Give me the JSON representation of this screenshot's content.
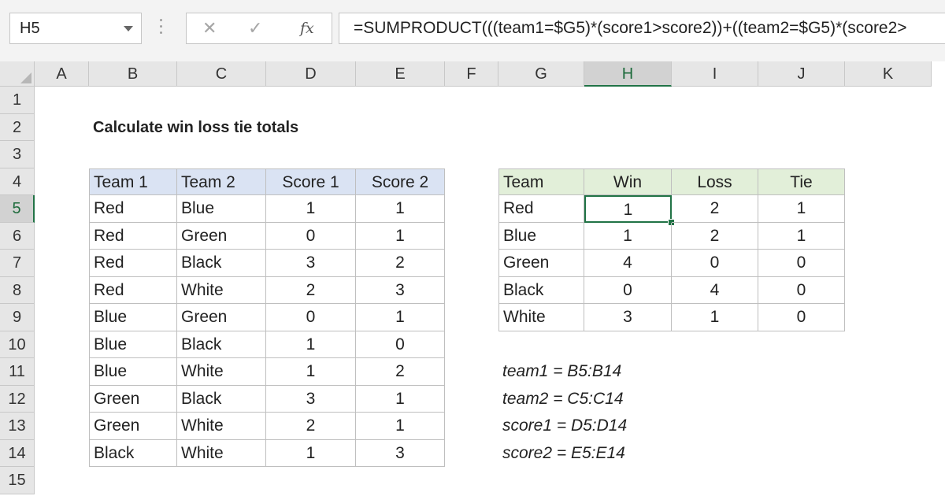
{
  "formula_bar": {
    "name_box": "H5",
    "cancel_icon": "✕",
    "enter_icon": "✓",
    "fx_label": "fx",
    "formula": "=SUMPRODUCT(((team1=$G5)*(score1>score2))+((team2=$G5)*(score2>"
  },
  "columns": [
    "A",
    "B",
    "C",
    "D",
    "E",
    "F",
    "G",
    "H",
    "I",
    "J",
    "K"
  ],
  "rows": [
    "1",
    "2",
    "3",
    "4",
    "5",
    "6",
    "7",
    "8",
    "9",
    "10",
    "11",
    "12",
    "13",
    "14",
    "15"
  ],
  "active_cell": "H5",
  "title": "Calculate win loss tie totals",
  "scores_table": {
    "headers": [
      "Team 1",
      "Team 2",
      "Score 1",
      "Score 2"
    ],
    "rows": [
      [
        "Red",
        "Blue",
        "1",
        "1"
      ],
      [
        "Red",
        "Green",
        "0",
        "1"
      ],
      [
        "Red",
        "Black",
        "3",
        "2"
      ],
      [
        "Red",
        "White",
        "2",
        "3"
      ],
      [
        "Blue",
        "Green",
        "0",
        "1"
      ],
      [
        "Blue",
        "Black",
        "1",
        "0"
      ],
      [
        "Blue",
        "White",
        "1",
        "2"
      ],
      [
        "Green",
        "Black",
        "3",
        "1"
      ],
      [
        "Green",
        "White",
        "2",
        "1"
      ],
      [
        "Black",
        "White",
        "1",
        "3"
      ]
    ]
  },
  "summary_table": {
    "headers": [
      "Team",
      "Win",
      "Loss",
      "Tie"
    ],
    "rows": [
      [
        "Red",
        "1",
        "2",
        "1"
      ],
      [
        "Blue",
        "1",
        "2",
        "1"
      ],
      [
        "Green",
        "4",
        "0",
        "0"
      ],
      [
        "Black",
        "0",
        "4",
        "0"
      ],
      [
        "White",
        "3",
        "1",
        "0"
      ]
    ]
  },
  "named_ranges": [
    "team1 = B5:B14",
    "team2 = C5:C14",
    "score1 = D5:D14",
    "score2 = E5:E14"
  ],
  "colors": {
    "accent": "#217346",
    "header_blue": "#dae3f3",
    "header_green": "#e2efd9"
  }
}
